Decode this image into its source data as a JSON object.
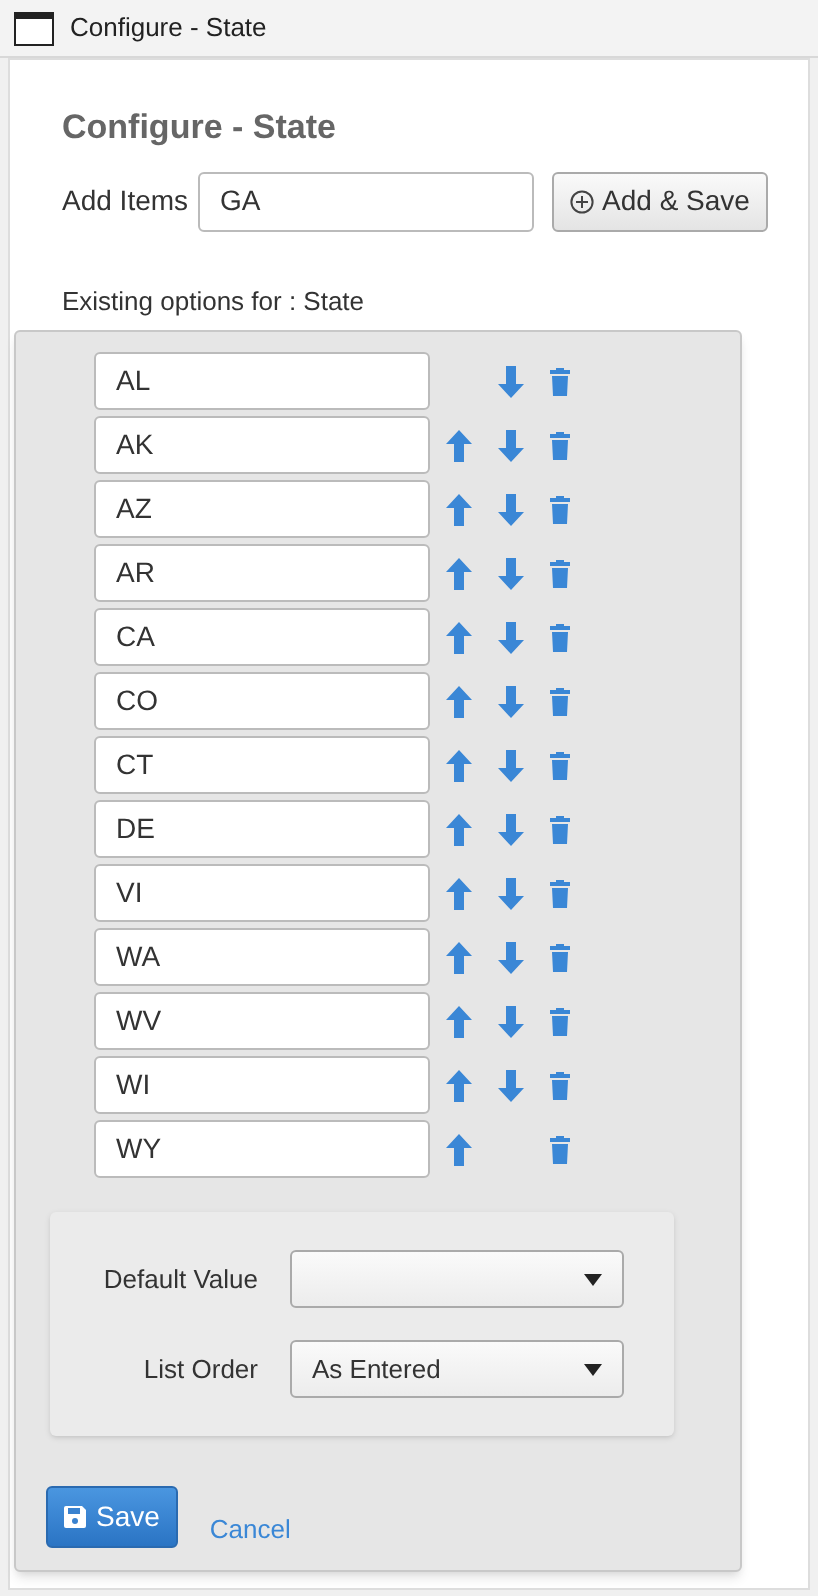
{
  "window": {
    "title": "Configure - State"
  },
  "heading": "Configure - State",
  "add_items": {
    "label": "Add Items",
    "value": "GA",
    "button": "Add & Save"
  },
  "options_label": "Existing options for : State",
  "options": [
    {
      "value": "AL",
      "up": false,
      "down": true
    },
    {
      "value": "AK",
      "up": true,
      "down": true
    },
    {
      "value": "AZ",
      "up": true,
      "down": true
    },
    {
      "value": "AR",
      "up": true,
      "down": true
    },
    {
      "value": "CA",
      "up": true,
      "down": true
    },
    {
      "value": "CO",
      "up": true,
      "down": true
    },
    {
      "value": "CT",
      "up": true,
      "down": true
    },
    {
      "value": "DE",
      "up": true,
      "down": true
    },
    {
      "value": "VI",
      "up": true,
      "down": true
    },
    {
      "value": "WA",
      "up": true,
      "down": true
    },
    {
      "value": "WV",
      "up": true,
      "down": true
    },
    {
      "value": "WI",
      "up": true,
      "down": true
    },
    {
      "value": "WY",
      "up": true,
      "down": false
    }
  ],
  "settings": [
    {
      "label": "Default Value"
    },
    {
      "label": "List Order",
      "value": "As Entered"
    }
  ],
  "buttons": {
    "save": "Save",
    "cancel": "Cancel"
  }
}
